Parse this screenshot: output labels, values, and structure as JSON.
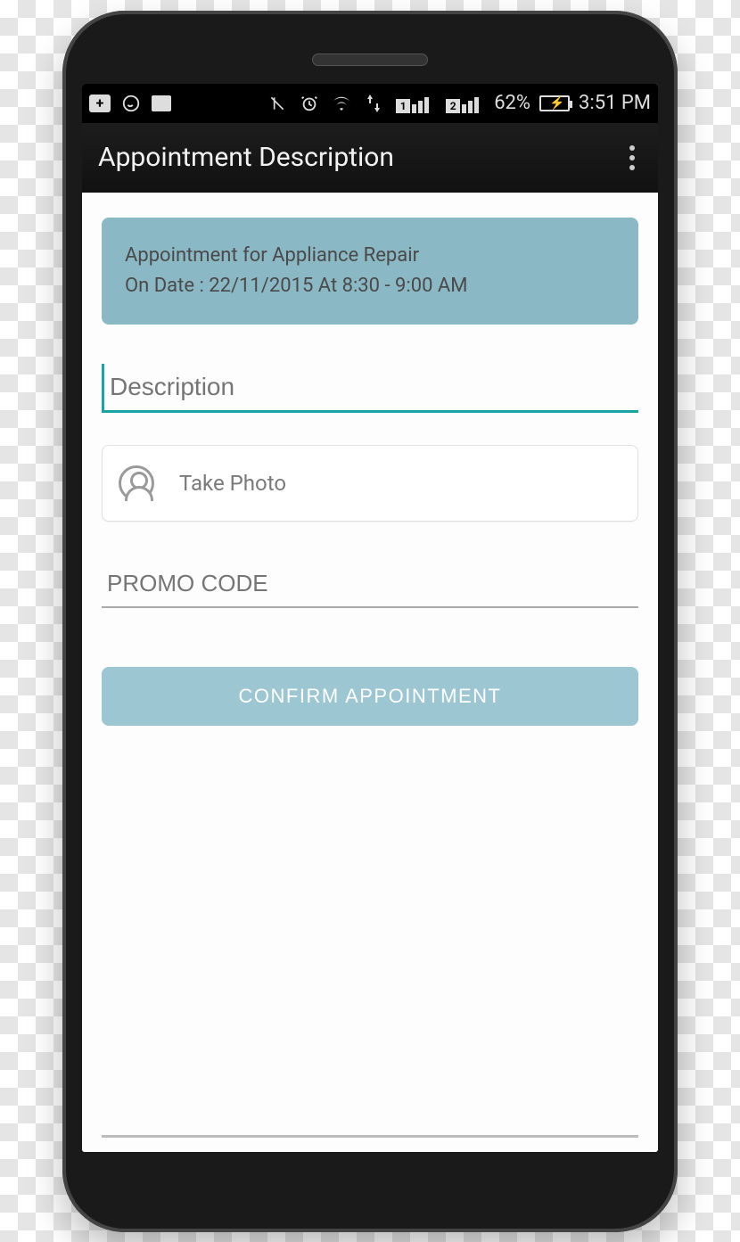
{
  "status": {
    "battery_pct": "62%",
    "time": "3:51 PM",
    "sim1_label": "1",
    "sim2_label": "2"
  },
  "header": {
    "title": "Appointment Description"
  },
  "info": {
    "line1": "Appointment for Appliance Repair",
    "line2": "On Date : 22/11/2015 At 8:30 - 9:00 AM"
  },
  "fields": {
    "description_placeholder": "Description",
    "take_photo_label": "Take Photo",
    "promo_placeholder": "PROMO CODE"
  },
  "buttons": {
    "confirm": "CONFIRM APPOINTMENT"
  },
  "colors": {
    "accent_teal": "#1aa3a3",
    "card_blue": "#8ab8c4",
    "button_blue": "#9cc6d2"
  }
}
